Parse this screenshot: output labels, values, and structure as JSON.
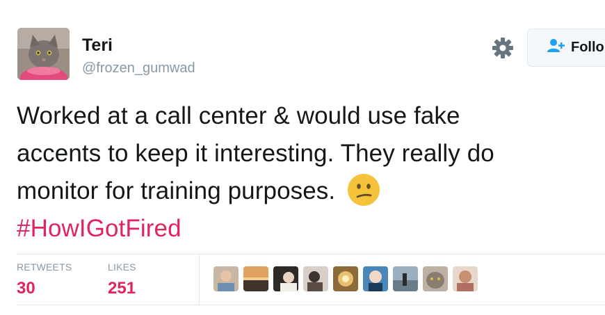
{
  "user": {
    "name": "Teri",
    "handle": "@frozen_gumwad"
  },
  "actions": {
    "follow_label": "Follo",
    "settings_icon": "gear-icon",
    "follow_icon": "add-user-icon"
  },
  "tweet": {
    "lines": [
      "Worked at a call center & would use fake",
      "accents to keep it interesting. They really do",
      "monitor for training purposes."
    ],
    "emoji": "confused-face",
    "hashtag": "#HowIGotFired"
  },
  "stats": {
    "retweets_label": "RETWEETS",
    "retweets_count": "30",
    "likes_label": "LIKES",
    "likes_count": "251"
  },
  "likers": [
    {
      "name": "liker-avatar-1"
    },
    {
      "name": "liker-avatar-2"
    },
    {
      "name": "liker-avatar-3"
    },
    {
      "name": "liker-avatar-4"
    },
    {
      "name": "liker-avatar-5"
    },
    {
      "name": "liker-avatar-6"
    },
    {
      "name": "liker-avatar-7"
    },
    {
      "name": "liker-avatar-8"
    },
    {
      "name": "liker-avatar-9"
    }
  ],
  "colors": {
    "text": "#14171a",
    "muted": "#8899a6",
    "accent_pink": "#e0245e",
    "follow_blue": "#1da1f2",
    "divider": "#e1e8ed"
  }
}
